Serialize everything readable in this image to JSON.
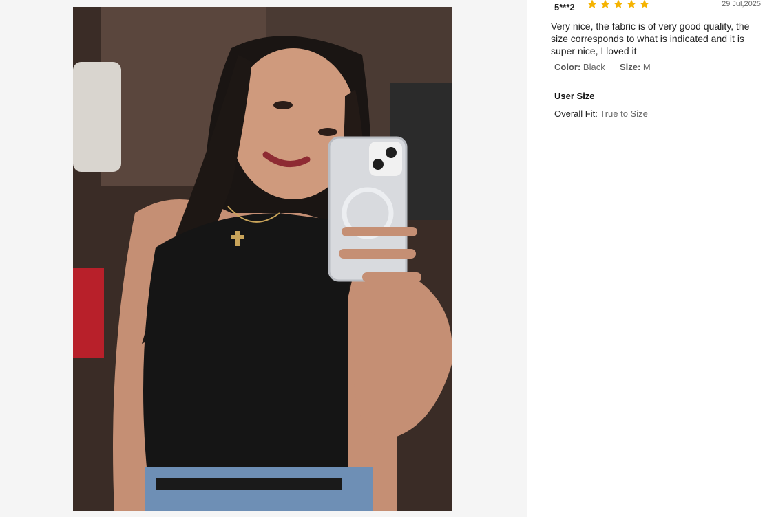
{
  "review": {
    "reviewer": "5***2",
    "rating": 5,
    "date": "29 Jul,2025",
    "text": "Very nice, the fabric is of very good quality, the size corresponds to what is indicated and it is super nice, I loved it",
    "color_label": "Color:",
    "color_value": "Black",
    "size_label": "Size:",
    "size_value": "M",
    "user_size_title": "User Size",
    "fit_label": "Overall Fit:",
    "fit_value": "True to Size"
  },
  "colors": {
    "star": "#f5b301",
    "gallery_background": "#f5f5f5"
  },
  "icons": {
    "rating": "star-icon"
  }
}
